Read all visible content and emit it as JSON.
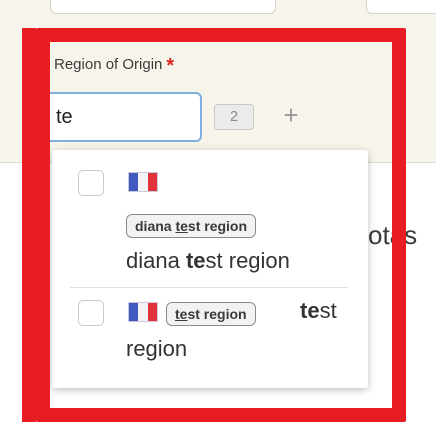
{
  "form": {
    "field_label": "Region of Origin",
    "required_mark": "*",
    "search_value": "te",
    "count_badge": "2",
    "add_symbol": "+"
  },
  "background": {
    "partial_text": "otas"
  },
  "dropdown": {
    "options": [
      {
        "chip_prefix": "diana ",
        "chip_match": "te",
        "chip_suffix": "st region",
        "text_prefix": "diana ",
        "text_match": "te",
        "text_suffix": "st region"
      },
      {
        "chip_match": "te",
        "chip_suffix": "st region",
        "text_match": "te",
        "text_suffix": "st",
        "text_line2": "region"
      }
    ]
  },
  "colors": {
    "highlight_frame": "#e81c23",
    "required": "#d9251d",
    "input_focus_border": "#7fb0df",
    "panel_background": "#f7f5eb"
  },
  "icons": {
    "flag": "flag-icon",
    "add": "plus-icon"
  }
}
